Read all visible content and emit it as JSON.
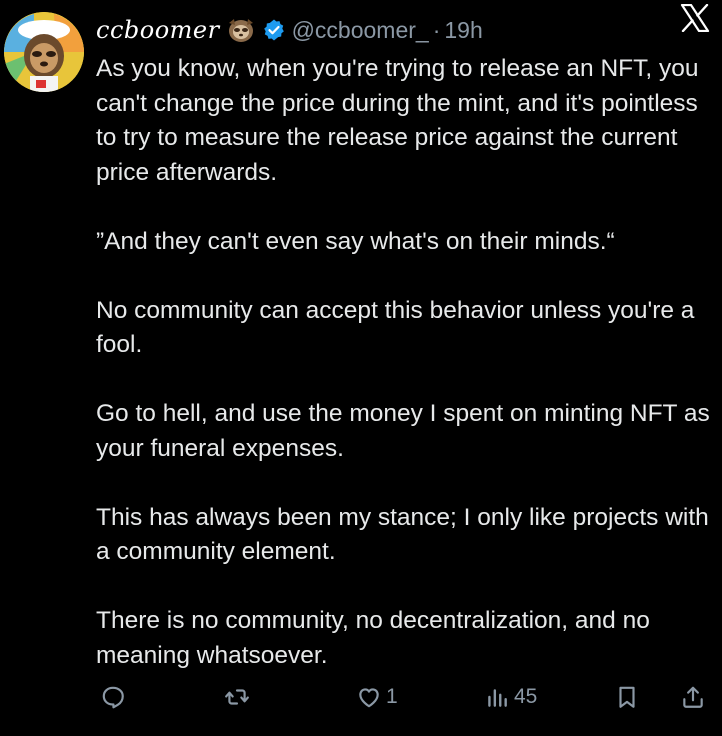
{
  "tweet": {
    "display_name": "ccboomer",
    "handle": "@ccboomer_",
    "separator": "·",
    "time": "19h",
    "paragraphs": [
      "As you know, when you're trying to release an NFT, you can't change the price during the mint, and it's pointless to try to measure the release price against the current price afterwards.",
      "”And they can't even say what's on their minds.“",
      "No community can accept this behavior unless you're a fool.",
      "Go to hell, and use the money I spent on minting NFT as your funeral expenses.",
      "This has always been my stance; I only like projects with a community element.",
      "There is no community, no decentralization, and no meaning whatsoever."
    ]
  },
  "actions": {
    "reply": {
      "icon": "reply-icon",
      "count": ""
    },
    "repost": {
      "icon": "repost-icon",
      "count": ""
    },
    "like": {
      "icon": "heart-icon",
      "count": "1"
    },
    "views": {
      "icon": "views-icon",
      "count": "45"
    },
    "bookmark": {
      "icon": "bookmark-icon"
    },
    "share": {
      "icon": "share-icon"
    }
  },
  "colors": {
    "background": "#000000",
    "text": "#e7e9ea",
    "muted": "#8b98a5",
    "verified": "#1d9bf0"
  }
}
